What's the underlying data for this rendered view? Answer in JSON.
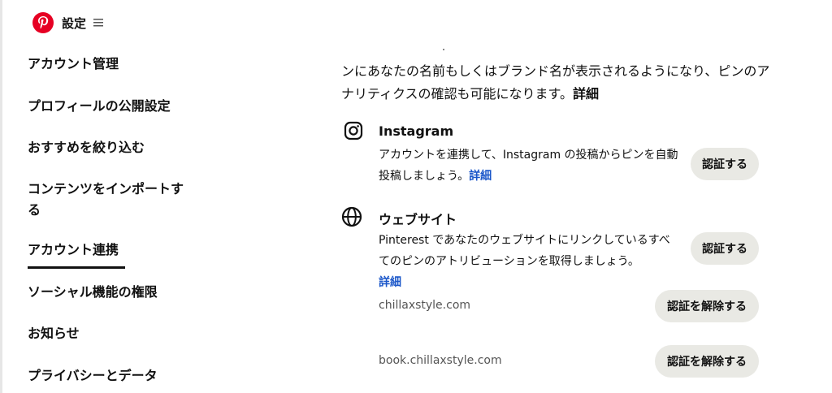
{
  "header": {
    "title": "設定",
    "logo_icon": "pinterest-logo",
    "menu_icon": "hamburger-icon",
    "brand_color": "#e60023"
  },
  "sidebar": {
    "items": [
      {
        "label": "アカウント管理"
      },
      {
        "label": "プロフィールの公開設定"
      },
      {
        "label": "おすすめを絞り込む"
      },
      {
        "label": "コンテンツをインポートする"
      },
      {
        "label": "アカウント連携",
        "active": true
      },
      {
        "label": "ソーシャル機能の権限"
      },
      {
        "label": "お知らせ"
      },
      {
        "label": "プライバシーとデータ"
      }
    ]
  },
  "main": {
    "intro_text": "ンにあなたの名前もしくはブランド名が表示されるようになり、ピンのアナリティクスの確認も可能になります。",
    "intro_link": "詳細",
    "instagram": {
      "icon": "instagram-icon",
      "title": "Instagram",
      "description": "アカウントを連携して、Instagram の投稿からピンを自動投稿しましょう。",
      "link": "詳細",
      "button": "認証する"
    },
    "website": {
      "icon": "globe-icon",
      "title": "ウェブサイト",
      "description": "Pinterest であなたのウェブサイトにリンクしているすべてのピンのアトリビューションを取得しましょう。",
      "link": "詳細",
      "button": "認証する",
      "domains": [
        {
          "name": "chillaxstyle.com",
          "button": "認証を解除する"
        },
        {
          "name": "book.chillaxstyle.com",
          "button": "認証を解除する"
        }
      ]
    },
    "link_color": "#1a56c9",
    "button_bg": "#e9e9e4"
  }
}
